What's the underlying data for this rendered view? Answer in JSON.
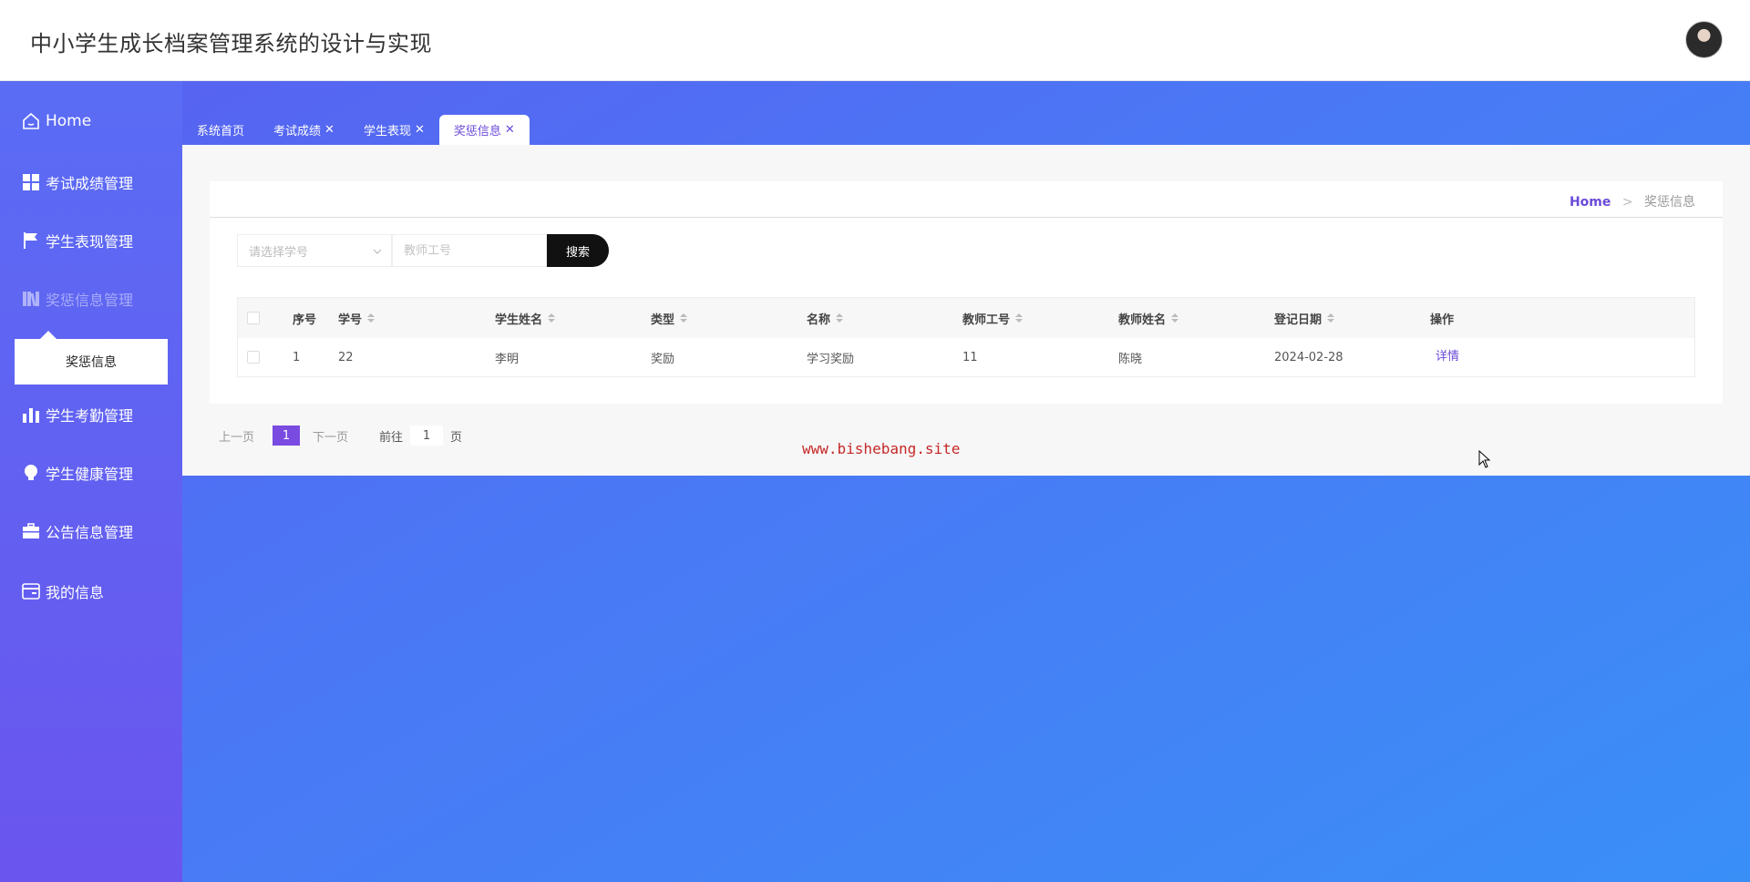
{
  "app": {
    "title": "中小学生成长档案管理系统的设计与实现"
  },
  "sidebar": {
    "items": [
      {
        "label": "Home",
        "icon": "home-icon"
      },
      {
        "label": "考试成绩管理",
        "icon": "grid-icon"
      },
      {
        "label": "学生表现管理",
        "icon": "flag-icon"
      },
      {
        "label": "奖惩信息管理",
        "icon": "book-icon"
      },
      {
        "label": "学生考勤管理",
        "icon": "bar-chart-icon"
      },
      {
        "label": "学生健康管理",
        "icon": "bulb-icon"
      },
      {
        "label": "公告信息管理",
        "icon": "briefcase-icon"
      },
      {
        "label": "我的信息",
        "icon": "card-icon"
      }
    ],
    "submenu": {
      "label": "奖惩信息"
    }
  },
  "tabs": [
    {
      "label": "系统首页",
      "closable": false
    },
    {
      "label": "考试成绩",
      "closable": true
    },
    {
      "label": "学生表现",
      "closable": true
    },
    {
      "label": "奖惩信息",
      "closable": true,
      "active": true
    }
  ],
  "breadcrumb": {
    "home": "Home",
    "sep": ">",
    "current": "奖惩信息"
  },
  "search": {
    "select_placeholder": "请选择学号",
    "input_placeholder": "教师工号",
    "button_label": "搜索"
  },
  "table": {
    "columns": [
      "序号",
      "学号",
      "学生姓名",
      "类型",
      "名称",
      "教师工号",
      "教师姓名",
      "登记日期",
      "操作"
    ],
    "rows": [
      {
        "index": "1",
        "student_id": "22",
        "student_name": "李明",
        "type": "奖励",
        "name": "学习奖励",
        "teacher_id": "11",
        "teacher_name": "陈晓",
        "date": "2024-02-28",
        "action": "详情"
      }
    ]
  },
  "pager": {
    "prev": "上一页",
    "current": "1",
    "next": "下一页",
    "goto_label": "前往",
    "goto_value": "1",
    "page_unit": "页"
  },
  "watermark": "www.bishebang.site",
  "colors": {
    "accent": "#6a4bd8",
    "sidebar_top": "#5a6cf4",
    "sidebar_bottom": "#6a55ee"
  }
}
